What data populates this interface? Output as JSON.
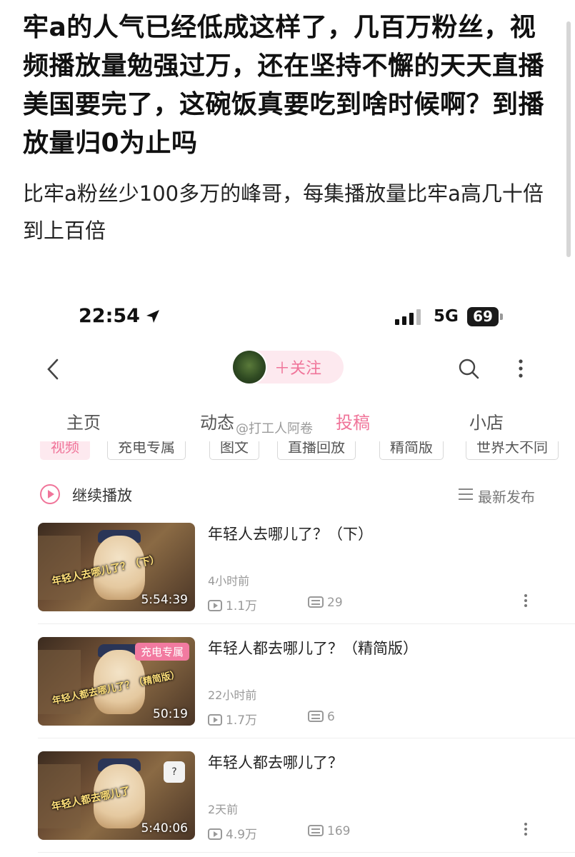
{
  "post": {
    "title": "牢a的人气已经低成这样了，几百万粉丝，视频播放量勉强过万，还在坚持不懈的天天直播美国要完了，这碗饭真要吃到啥时候啊？到播放量归0为止吗",
    "body": "比牢a粉丝少100多万的峰哥，每集播放量比牢a高几十倍到上百倍"
  },
  "status_bar": {
    "time": "22:54",
    "network": "5G",
    "battery": "69"
  },
  "profile": {
    "follow_label": "＋关注"
  },
  "tabs": [
    {
      "label": "主页",
      "active": false
    },
    {
      "label": "动态",
      "active": false
    },
    {
      "label": "投稿",
      "active": true
    },
    {
      "label": "小店",
      "active": false
    }
  ],
  "watermark": "@打工人阿卷",
  "filters": [
    "视频",
    "充电专属",
    "图文",
    "直播回放",
    "精简版",
    "世界大不同"
  ],
  "continue_label": "继续播放",
  "sort_label": "最新发布",
  "videos": [
    {
      "title": "年轻人去哪儿了？（下）",
      "thumb_title": "年轻人去哪儿了？（下）",
      "duration": "5:54:39",
      "time": "4小时前",
      "views": "1.1万",
      "danmaku": "29",
      "badge": ""
    },
    {
      "title": "年轻人都去哪儿了？（精简版）",
      "thumb_title": "年轻人都去哪儿了？（精简版）",
      "duration": "50:19",
      "time": "22小时前",
      "views": "1.7万",
      "danmaku": "6",
      "badge": "充电专属"
    },
    {
      "title": "年轻人都去哪儿了？",
      "thumb_title": "年轻人都去哪儿了",
      "duration": "5:40:06",
      "time": "2天前",
      "views": "4.9万",
      "danmaku": "169",
      "badge": ""
    }
  ],
  "colors": {
    "accent": "#f0759a",
    "accent_bg": "#fde9ef"
  }
}
